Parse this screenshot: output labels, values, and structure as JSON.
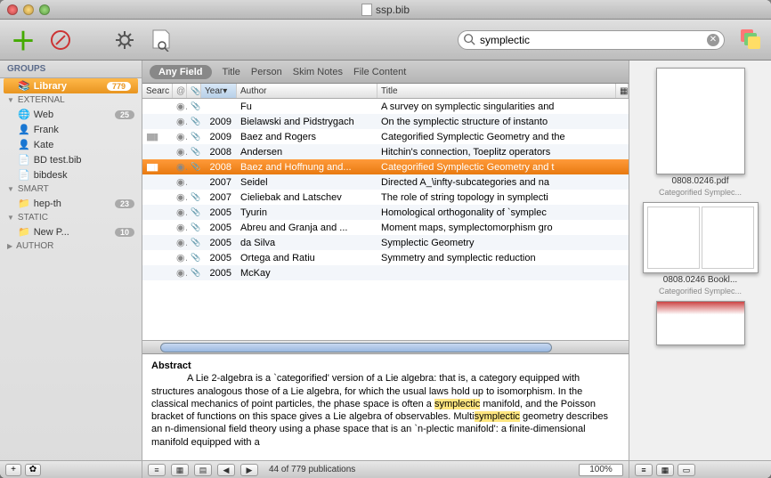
{
  "window_title": "ssp.bib",
  "search": {
    "value": "symplectic",
    "placeholder": ""
  },
  "sidebar": {
    "header": "GROUPS",
    "library": {
      "label": "Library",
      "count": "779"
    },
    "sections": [
      {
        "name": "EXTERNAL",
        "items": [
          {
            "label": "Web",
            "count": "25",
            "icon": "globe"
          },
          {
            "label": "Frank",
            "count": "",
            "icon": "person"
          },
          {
            "label": "Kate",
            "count": "",
            "icon": "person"
          },
          {
            "label": "BD test.bib",
            "count": "",
            "icon": "doc"
          },
          {
            "label": "bibdesk",
            "count": "",
            "icon": "doc"
          }
        ]
      },
      {
        "name": "SMART",
        "items": [
          {
            "label": "hep-th",
            "count": "23",
            "icon": "folder"
          }
        ]
      },
      {
        "name": "STATIC",
        "items": [
          {
            "label": "New P...",
            "count": "10",
            "icon": "folder"
          }
        ]
      },
      {
        "name": "AUTHOR",
        "items": []
      }
    ]
  },
  "scope_bar": [
    "Any Field",
    "Title",
    "Person",
    "Skim Notes",
    "File Content"
  ],
  "columns": {
    "searc": "Searc",
    "at": "@",
    "clip": "",
    "year": "Year",
    "author": "Author",
    "title": "Title"
  },
  "rows": [
    {
      "year": "",
      "author": "Fu",
      "title": "A survey on symplectic singularities and",
      "clip": true,
      "at": true
    },
    {
      "year": "2009",
      "author": "Bielawski and Pidstrygach",
      "title": "On the symplectic structure of instanto",
      "clip": true,
      "at": true
    },
    {
      "year": "2009",
      "author": "Baez and Rogers",
      "title": "Categorified Symplectic Geometry and the",
      "clip": true,
      "at": true,
      "hatch": true
    },
    {
      "year": "2008",
      "author": "Andersen",
      "title": "Hitchin's connection, Toeplitz operators",
      "clip": true,
      "at": true
    },
    {
      "year": "2008",
      "author": "Baez and Hoffnung and...",
      "title": "Categorified Symplectic Geometry and t",
      "clip": true,
      "at": true,
      "selected": true
    },
    {
      "year": "2007",
      "author": "Seidel",
      "title": "Directed A_\\infty-subcategories and na",
      "clip": false,
      "at": true
    },
    {
      "year": "2007",
      "author": "Cieliebak and Latschev",
      "title": "The role of string topology in symplecti",
      "clip": true,
      "at": true
    },
    {
      "year": "2005",
      "author": "Tyurin",
      "title": "Homological orthogonality of `symplec",
      "clip": true,
      "at": true
    },
    {
      "year": "2005",
      "author": "Abreu and Granja and ...",
      "title": "Moment maps, symplectomorphism gro",
      "clip": true,
      "at": true
    },
    {
      "year": "2005",
      "author": "da Silva",
      "title": "Symplectic Geometry",
      "clip": true,
      "at": true
    },
    {
      "year": "2005",
      "author": "Ortega and Ratiu",
      "title": "Symmetry and symplectic reduction",
      "clip": true,
      "at": true
    },
    {
      "year": "2005",
      "author": "McKay",
      "title": "",
      "clip": true,
      "at": true
    }
  ],
  "abstract": {
    "heading": "Abstract",
    "text_before": "A Lie 2-algebra is a `categorified' version of a Lie algebra: that is, a category equipped with structures analogous those of a Lie algebra, for which the usual laws hold up to isomorphism. In the classical mechanics of point particles, the phase space is often a ",
    "hl1": "symplectic",
    "text_mid": " manifold, and the Poisson bracket of functions on this space gives a Lie algebra of observables. Multi",
    "hl2": "symplectic",
    "text_after": " geometry describes an n-dimensional field theory using a phase space that is an `n-plectic manifold': a finite-dimensional manifold equipped with a"
  },
  "status": {
    "count": "44 of 779 publications",
    "zoom": "100%"
  },
  "thumbs": [
    {
      "title": "0808.0246.pdf",
      "sub": "Categorified Symplec..."
    },
    {
      "title": "0808.0246 Bookl...",
      "sub": "Categorified Symplec..."
    }
  ]
}
